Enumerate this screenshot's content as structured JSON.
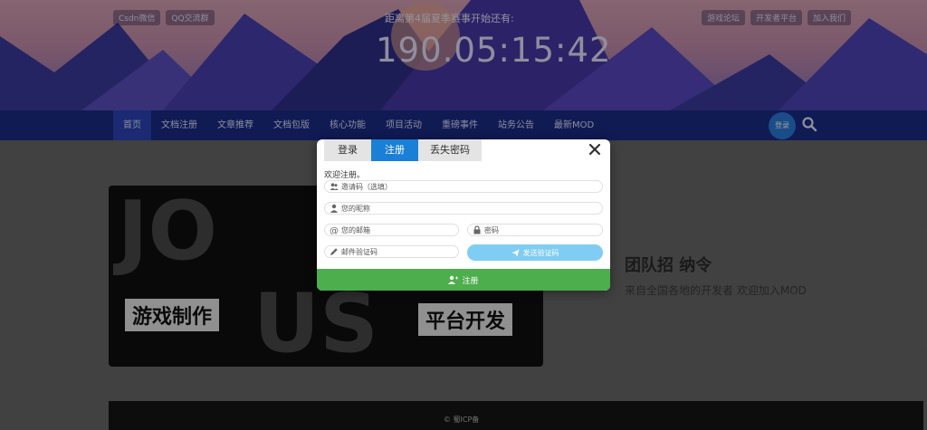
{
  "header": {
    "left_pills": [
      "Csdn微信",
      "QQ交流群"
    ],
    "right_pills": [
      "游戏论坛",
      "开发者平台",
      "加入我们"
    ],
    "countdown_title": "距离第4届夏季赛事开始还有:",
    "countdown": "190.05:15:42"
  },
  "nav": {
    "items": [
      "首页",
      "文档注册",
      "文章推荐",
      "文档包版",
      "核心功能",
      "项目活动",
      "重磅事件",
      "站务公告",
      "最新MOD"
    ],
    "button_label": "登录"
  },
  "banner": {
    "big_text_1": "JO",
    "big_text_2": "US",
    "tag_left": "游戏制作",
    "tag_right": "平台开发",
    "side_text": "团队招 纳令",
    "side_sub": "来自全国各地的开发者 欢迎加入MOD"
  },
  "footer": {
    "note": "© 蜀ICP备"
  },
  "modal": {
    "tabs": [
      "登录",
      "注册",
      "丢失密码"
    ],
    "active_tab": 1,
    "welcome": "欢迎注册。",
    "invite_placeholder": "邀请码（选填）",
    "nickname_placeholder": "您的昵称",
    "email_placeholder": "您的邮箱",
    "password_placeholder": "密码",
    "code_placeholder": "邮件验证码",
    "send_code_label": "发送验证码",
    "submit_label": "注册",
    "colors": {
      "tab_active": "#1a7fd6",
      "submit": "#4cae4c",
      "send_code": "#7fcdf2"
    }
  }
}
